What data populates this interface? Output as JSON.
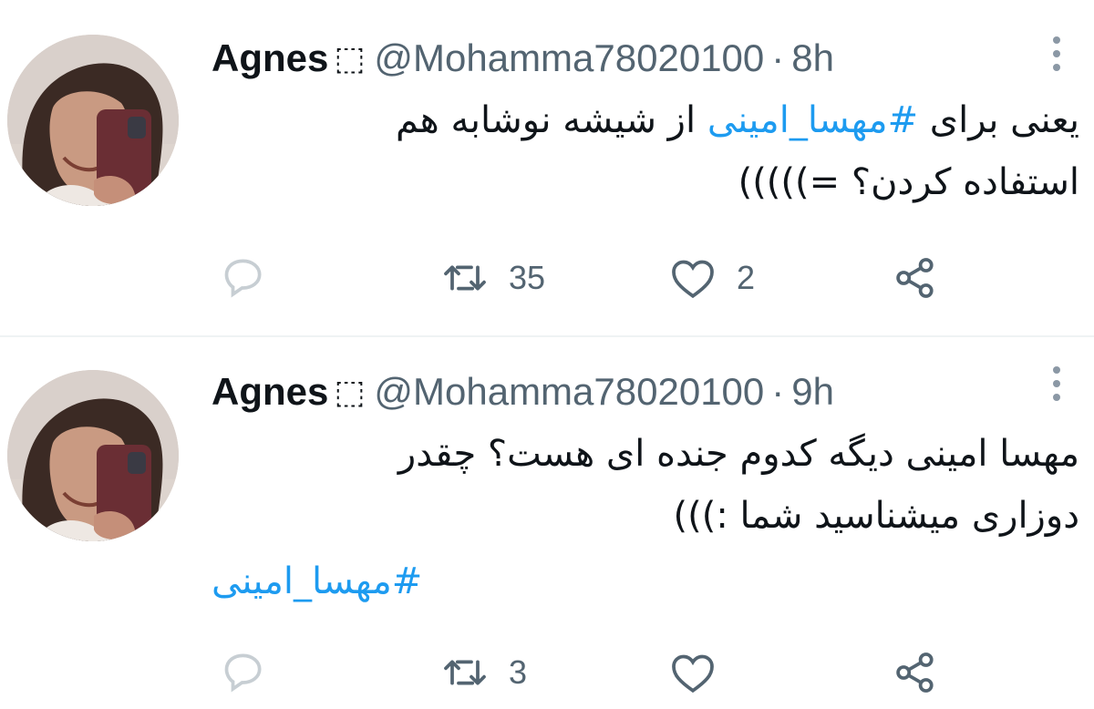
{
  "tweets": [
    {
      "author": {
        "name": "Agnes",
        "badge": "⬚",
        "handle": "@Mohamma78020100"
      },
      "separator": "·",
      "time": "8h",
      "text_line1_pre": "یعنی برای ",
      "hashtag": "#مهسا_امینی",
      "text_line1_post": " از شیشه نوشابه هم",
      "text_line2": "استفاده کردن؟ =)))))",
      "actions": {
        "replies": "",
        "retweets": "35",
        "likes": "2"
      },
      "icons": [
        "reply-icon",
        "retweet-icon",
        "heart-icon",
        "share-icon",
        "more-icon"
      ]
    },
    {
      "author": {
        "name": "Agnes",
        "badge": "⬚",
        "handle": "@Mohamma78020100"
      },
      "separator": "·",
      "time": "9h",
      "text_line1": "مهسا امینی دیگه کدوم جنده ای هست؟ چقدر",
      "text_line2": "دوزاری میشناسید شما :)))",
      "hashtag": "#مهسا_امینی",
      "actions": {
        "replies": "",
        "retweets": "3",
        "likes": ""
      },
      "icons": [
        "reply-icon",
        "retweet-icon",
        "heart-icon",
        "share-icon",
        "more-icon"
      ]
    }
  ],
  "colors": {
    "text": "#0f1419",
    "secondary": "#536471",
    "link": "#1d9bf0",
    "divider": "#eff3f4"
  }
}
